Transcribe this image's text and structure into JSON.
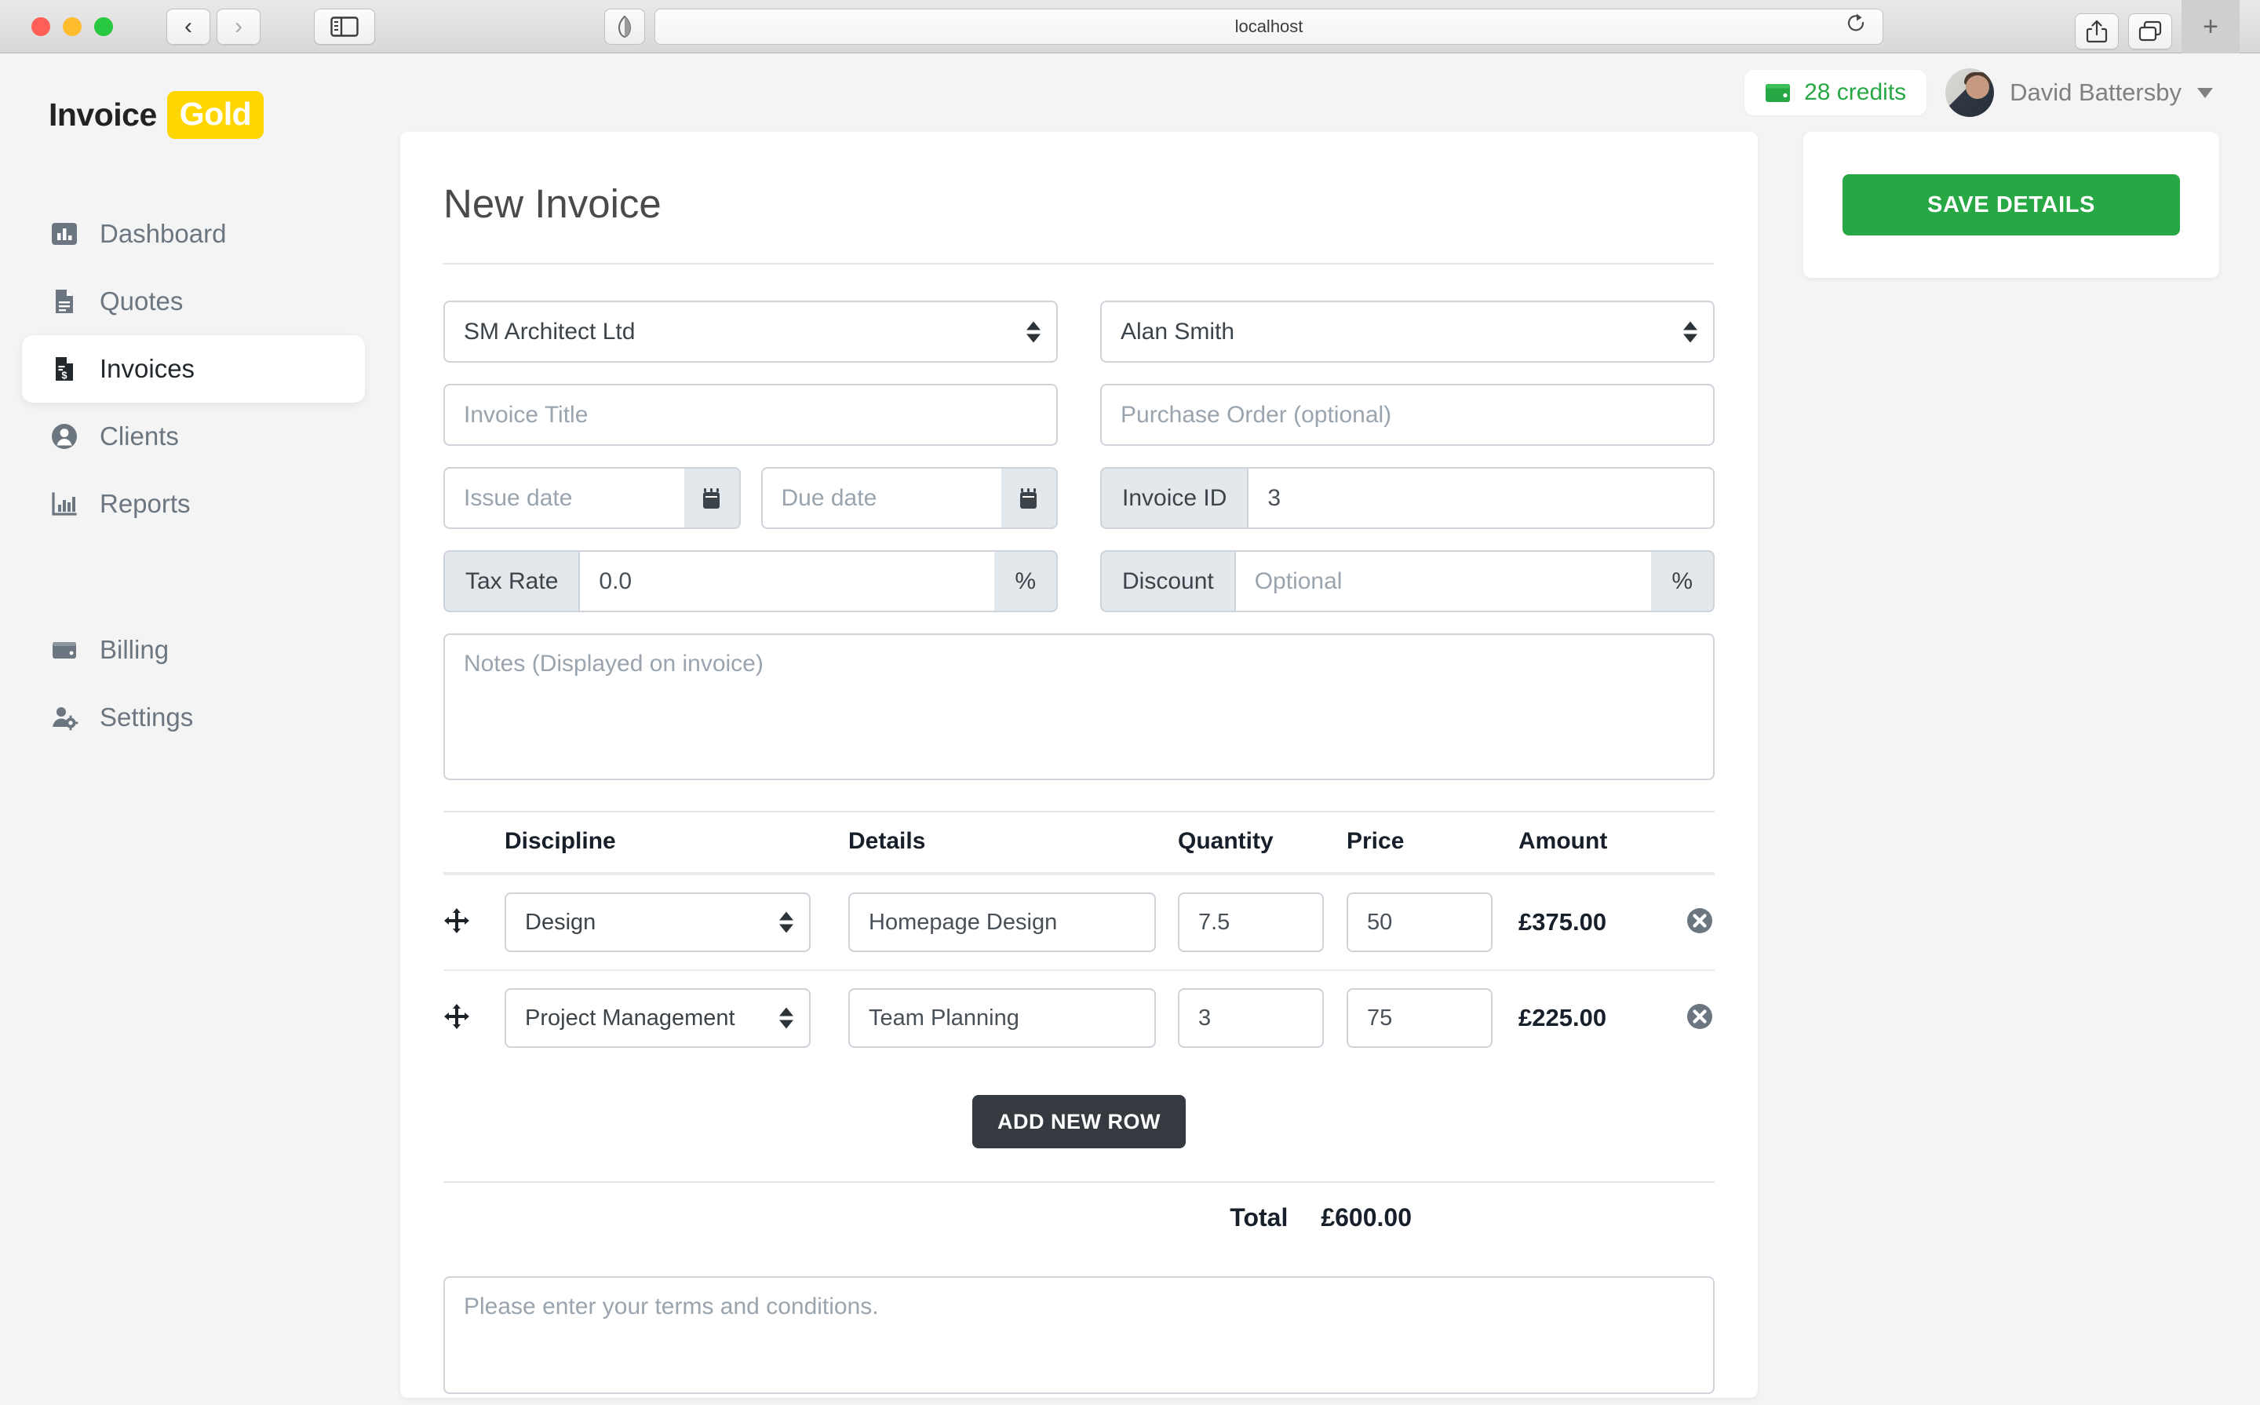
{
  "browser": {
    "url": "localhost",
    "back_label": "‹",
    "forward_label": "›"
  },
  "brand": {
    "name_primary": "Invoice",
    "name_accent": "Gold",
    "accent_color": "#ffd600"
  },
  "sidebar": {
    "items": [
      {
        "label": "Dashboard",
        "icon": "chart-bar-icon",
        "active": false
      },
      {
        "label": "Quotes",
        "icon": "document-icon",
        "active": false
      },
      {
        "label": "Invoices",
        "icon": "invoice-dollar-icon",
        "active": true
      },
      {
        "label": "Clients",
        "icon": "user-circle-icon",
        "active": false
      },
      {
        "label": "Reports",
        "icon": "chart-report-icon",
        "active": false
      },
      {
        "label": "Billing",
        "icon": "wallet-icon",
        "active": false
      },
      {
        "label": "Settings",
        "icon": "user-gear-icon",
        "active": false
      }
    ]
  },
  "topbar": {
    "credits_label": "28 credits",
    "credits_color": "#27a844",
    "credits_icon": "wallet-icon",
    "user_name": "David Battersby",
    "avatar_icon": "avatar"
  },
  "side_panel": {
    "save_label": "SAVE DETAILS",
    "save_color": "#28a745"
  },
  "invoice": {
    "title": "New Invoice",
    "company_select": {
      "value": "SM Architect Ltd",
      "options": [
        "SM Architect Ltd"
      ]
    },
    "contact_select": {
      "value": "Alan Smith",
      "options": [
        "Alan Smith"
      ]
    },
    "invoice_title": {
      "value": "",
      "placeholder": "Invoice Title"
    },
    "purchase_order": {
      "value": "",
      "placeholder": "Purchase Order (optional)"
    },
    "issue_date": {
      "value": "",
      "placeholder": "Issue date",
      "icon": "calendar-icon"
    },
    "due_date": {
      "value": "",
      "placeholder": "Due date",
      "icon": "calendar-icon"
    },
    "invoice_id": {
      "label": "Invoice ID",
      "value": "3"
    },
    "tax_rate": {
      "label": "Tax Rate",
      "value": "0.0",
      "suffix": "%"
    },
    "discount": {
      "label": "Discount",
      "value": "",
      "placeholder": "Optional",
      "suffix": "%"
    },
    "notes": {
      "value": "",
      "placeholder": "Notes (Displayed on invoice)"
    },
    "terms": {
      "value": "",
      "placeholder": "Please enter your terms and conditions."
    },
    "table": {
      "headers": [
        "Discipline",
        "Details",
        "Quantity",
        "Price",
        "Amount"
      ],
      "rows": [
        {
          "discipline": "Design",
          "details": "Homepage Design",
          "quantity": "7.5",
          "price": "50",
          "amount": "£375.00"
        },
        {
          "discipline": "Project Management",
          "details": "Team Planning",
          "quantity": "3",
          "price": "75",
          "amount": "£225.00"
        }
      ]
    },
    "add_row_label": "ADD NEW ROW",
    "total_label": "Total",
    "total_value": "£600.00"
  }
}
